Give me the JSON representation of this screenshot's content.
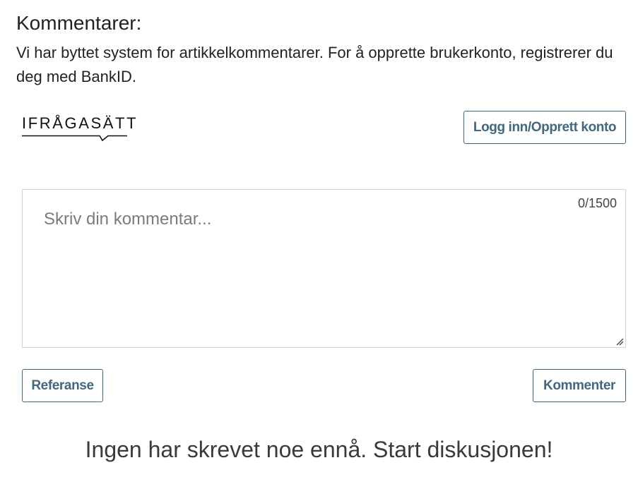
{
  "comments": {
    "heading": "Kommentarer:",
    "intro": "Vi har byttet system for artikkelkommentarer. For å opprette brukerkonto, registrerer du deg med BankID.",
    "logo_text": "IFRÅGASÄTT",
    "login_button": "Logg inn/Opprett konto",
    "textarea_placeholder": "Skriv din kommentar...",
    "textarea_value": "",
    "char_counter": "0/1500",
    "reference_button": "Referanse",
    "submit_button": "Kommenter",
    "empty_message": "Ingen har skrevet noe ennå. Start diskusjonen!"
  },
  "colors": {
    "accent": "#41687f",
    "text": "#222222",
    "border": "#d4d4d4"
  }
}
